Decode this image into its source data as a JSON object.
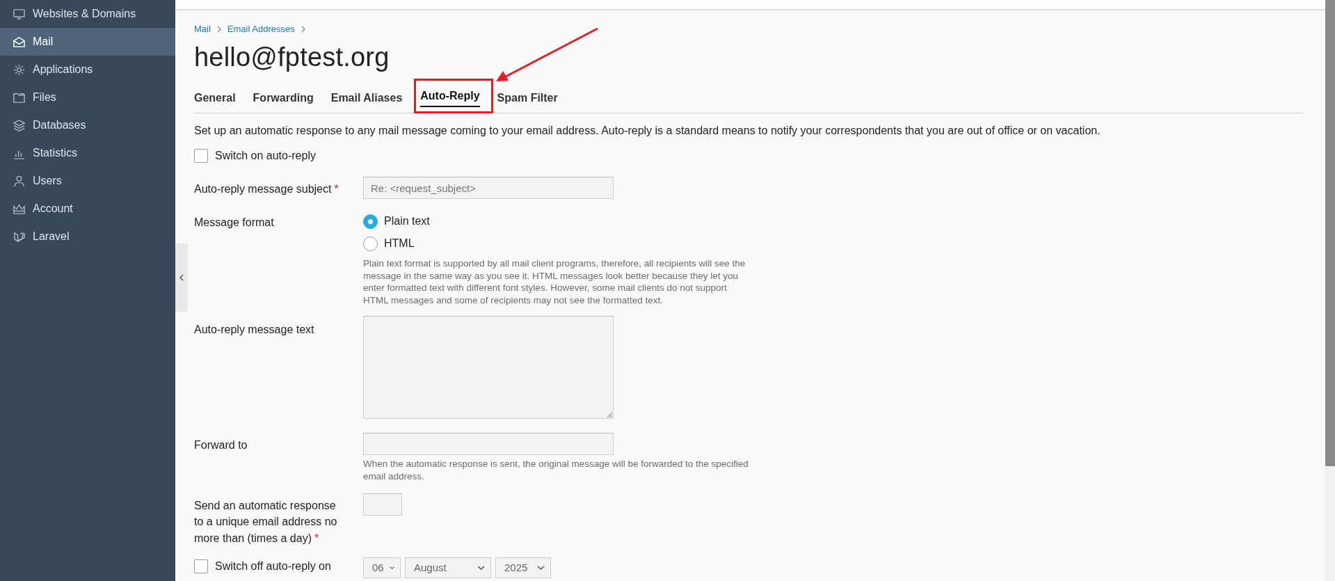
{
  "sidebar": {
    "items": [
      {
        "label": "Websites & Domains",
        "selected": false
      },
      {
        "label": "Mail",
        "selected": true
      },
      {
        "label": "Applications",
        "selected": false
      },
      {
        "label": "Files",
        "selected": false
      },
      {
        "label": "Databases",
        "selected": false
      },
      {
        "label": "Statistics",
        "selected": false
      },
      {
        "label": "Users",
        "selected": false
      },
      {
        "label": "Account",
        "selected": false
      },
      {
        "label": "Laravel",
        "selected": false
      }
    ]
  },
  "breadcrumb": [
    "Mail",
    "Email Addresses"
  ],
  "title": "hello@fptest.org",
  "tabs": [
    {
      "label": "General",
      "selected": false,
      "annotated": false
    },
    {
      "label": "Forwarding",
      "selected": false,
      "annotated": false
    },
    {
      "label": "Email Aliases",
      "selected": false,
      "annotated": false
    },
    {
      "label": "Auto-Reply",
      "selected": true,
      "annotated": true
    },
    {
      "label": "Spam Filter",
      "selected": false,
      "annotated": false
    }
  ],
  "description": "Set up an automatic response to any mail message coming to your email address. Auto-reply is a standard means to notify your correspondents that you are out of office or on vacation.",
  "form": {
    "rows": [
      {
        "kind": "checkbox",
        "label": "Switch on auto-reply",
        "checked": false
      },
      {
        "kind": "text",
        "label": "Auto-reply message subject",
        "required_mark": "*",
        "value": "Re: <request_subject>",
        "disabled": true
      },
      {
        "kind": "radio",
        "label": "Message format",
        "options": [
          {
            "label": "Plain text",
            "selected": true
          },
          {
            "label": "HTML",
            "selected": false
          }
        ],
        "hint": "Plain text format is supported by all mail client programs, therefore, all recipients will see the message in the same way as you see it. HTML messages look better because they let you enter formatted text with different font styles. However, some mail clients do not support HTML messages and some of recipients may not see the formatted text."
      },
      {
        "kind": "textarea",
        "label": "Auto-reply message text",
        "disabled": true
      },
      {
        "kind": "text",
        "label": "Forward to",
        "disabled": true,
        "hint": "When the automatic response is sent, the original message will be forwarded to the specified email address."
      },
      {
        "kind": "number",
        "label": "Send an automatic response to a unique email address no more than (times a day)",
        "required_mark": "*",
        "disabled": true
      },
      {
        "kind": "date",
        "label": "Switch off auto-reply on",
        "checked": false,
        "selects": [
          "06",
          "August",
          "2025"
        ]
      }
    ]
  }
}
